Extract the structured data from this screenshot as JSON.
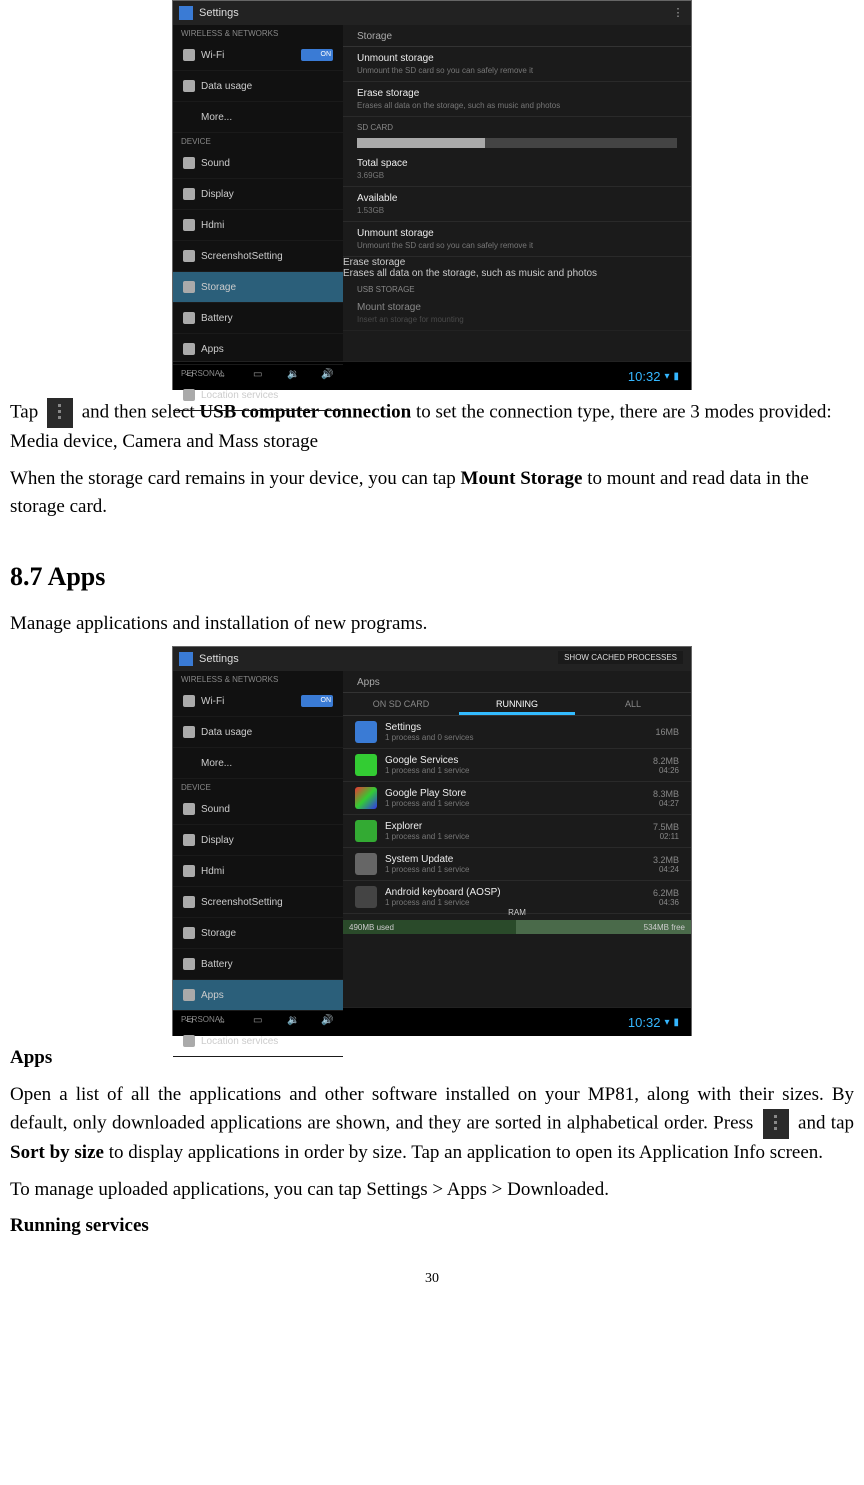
{
  "page_number": "30",
  "screenshot1": {
    "title": "Settings",
    "sidebar": {
      "group1_label": "WIRELESS & NETWORKS",
      "wifi": "Wi-Fi",
      "wifi_toggle": "ON",
      "data": "Data usage",
      "more": "More...",
      "group2_label": "DEVICE",
      "sound": "Sound",
      "display": "Display",
      "hdmi": "Hdmi",
      "screenshot": "ScreenshotSetting",
      "storage": "Storage",
      "battery": "Battery",
      "apps": "Apps",
      "group3_label": "PERSONAL",
      "location": "Location services"
    },
    "main": {
      "heading": "Storage",
      "item0_t": "Unmount storage",
      "item0_s": "Unmount the SD card so you can safely remove it",
      "item1_t": "Erase storage",
      "item1_s": "Erases all data on the storage, such as music and photos",
      "cat1": "SD CARD",
      "item2_t": "Total space",
      "item2_s": "3.69GB",
      "item3_t": "Available",
      "item3_s": "1.53GB",
      "item4_t": "Unmount storage",
      "item4_s": "Unmount the SD card so you can safely remove it",
      "item5_t": "Erase storage",
      "item5_s": "Erases all data on the storage, such as music and photos",
      "cat2": "USB STORAGE",
      "item6_t": "Mount storage",
      "item6_s": "Insert an storage for mounting"
    },
    "clock": "10:32"
  },
  "body": {
    "p1a": "Tap",
    "p1b": "and then select ",
    "p1_bold1": "USB computer connection",
    "p1c": " to set the connection type, there are 3 modes provided: Media device, Camera and Mass storage",
    "p2a": "When the storage card remains in your device, you can tap ",
    "p2_bold1": "Mount Storage",
    "p2b": " to mount and read data in the storage card.",
    "h2": "8.7 Apps",
    "p3": "Manage applications and installation of new programs."
  },
  "screenshot2": {
    "title": "Settings",
    "show_cached": "SHOW CACHED PROCESSES",
    "sidebar": {
      "group1_label": "WIRELESS & NETWORKS",
      "wifi": "Wi-Fi",
      "wifi_toggle": "ON",
      "data": "Data usage",
      "more": "More...",
      "group2_label": "DEVICE",
      "sound": "Sound",
      "display": "Display",
      "hdmi": "Hdmi",
      "screenshot": "ScreenshotSetting",
      "storage": "Storage",
      "battery": "Battery",
      "apps": "Apps",
      "group3_label": "PERSONAL",
      "location": "Location services"
    },
    "tabs": {
      "t1": "ON SD CARD",
      "t2": "RUNNING",
      "t3": "ALL"
    },
    "heading": "Apps",
    "apps": [
      {
        "name": "Settings",
        "sub": "1 process and 0 services",
        "r1": "16MB",
        "r2": ""
      },
      {
        "name": "Google Services",
        "sub": "1 process and 1 service",
        "r1": "8.2MB",
        "r2": "04:26"
      },
      {
        "name": "Google Play Store",
        "sub": "1 process and 1 service",
        "r1": "8.3MB",
        "r2": "04:27"
      },
      {
        "name": "Explorer",
        "sub": "1 process and 1 service",
        "r1": "7.5MB",
        "r2": "02:11"
      },
      {
        "name": "System Update",
        "sub": "1 process and 1 service",
        "r1": "3.2MB",
        "r2": "04:24"
      },
      {
        "name": "Android keyboard (AOSP)",
        "sub": "1 process and 1 service",
        "r1": "6.2MB",
        "r2": "04:36"
      }
    ],
    "ram": {
      "label": "RAM",
      "used": "490MB used",
      "free": "534MB free"
    },
    "clock": "10:32"
  },
  "body2": {
    "h_apps": "Apps",
    "p4": "Open a list of all the applications and other software installed on your MP81, along with their sizes. By default, only downloaded applications are shown, and they are sorted in alphabetical order. Press ",
    "p4b": " and tap ",
    "p4_bold": "Sort by size",
    "p4c": " to display applications in order by size. Tap an application to open its Application Info screen.",
    "p5": "To manage uploaded applications, you can tap Settings > Apps > Downloaded.",
    "h_running": "Running services"
  }
}
